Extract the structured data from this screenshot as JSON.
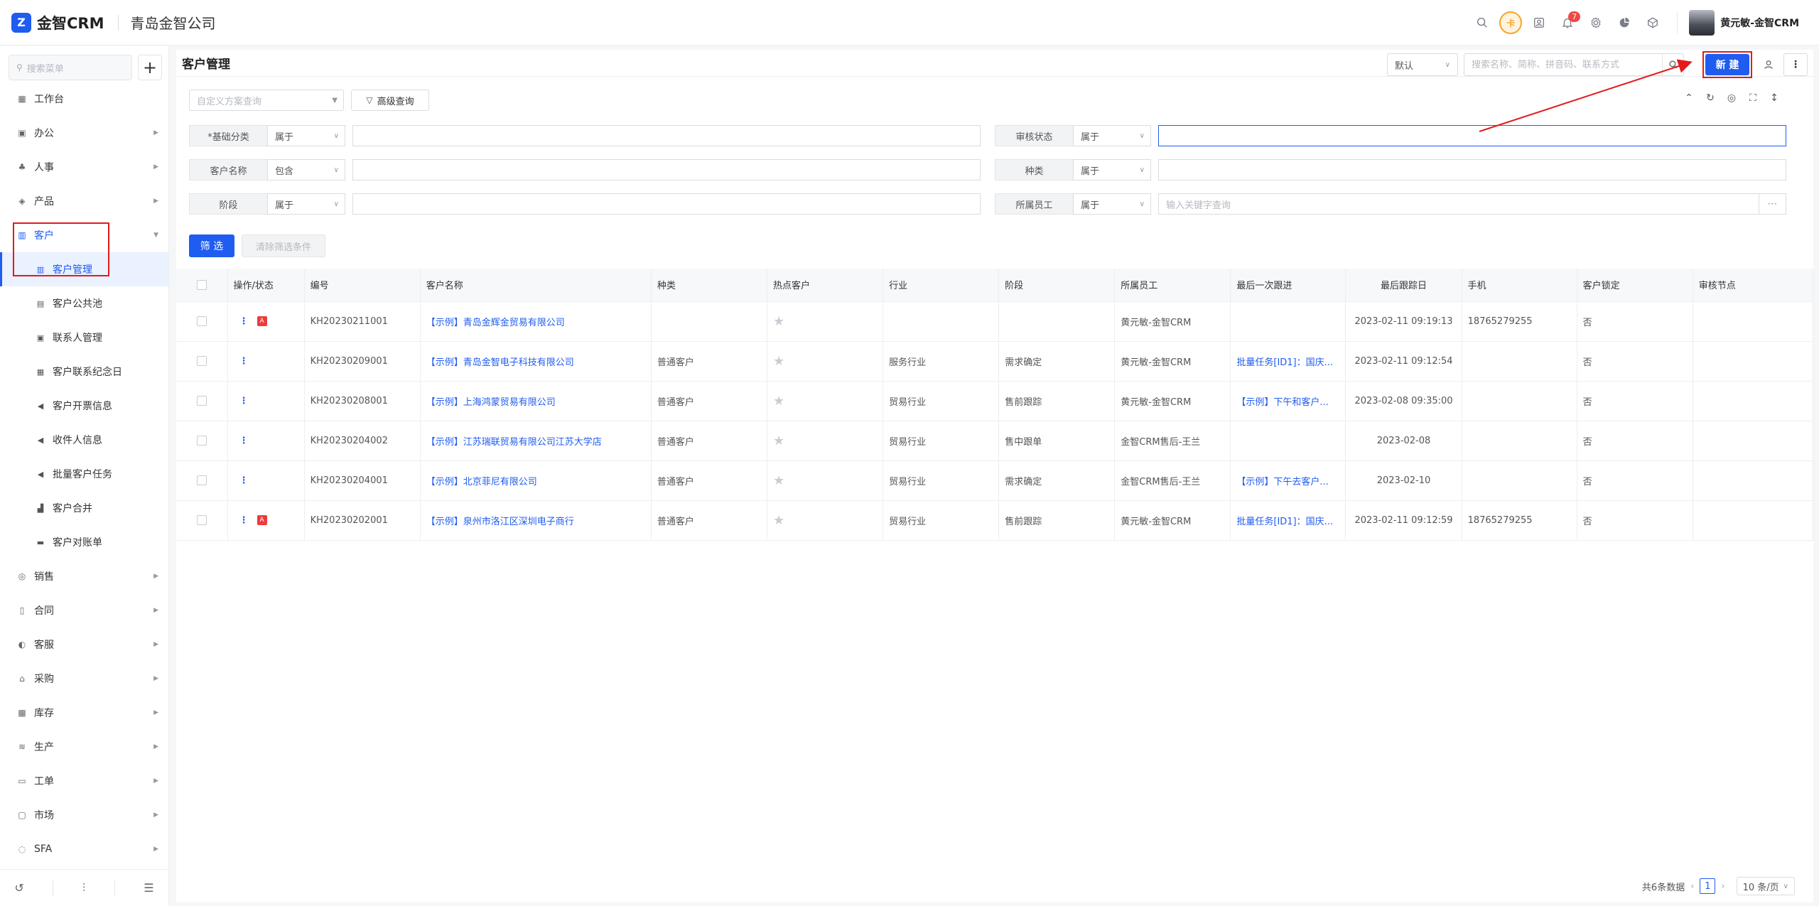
{
  "topbar": {
    "logo_mark": "Z",
    "app_name": "金智CRM",
    "company": "青岛金智公司",
    "notif_count": "7",
    "orange_icon_label": "卡",
    "user_name": "黄元敏-金智CRM"
  },
  "sidebar": {
    "search_placeholder": "搜索菜单",
    "add_label": "+",
    "items_top": [
      {
        "label": "工作台",
        "icon": "dashboard-icon",
        "glyph": "▦"
      },
      {
        "label": "办公",
        "icon": "office-icon",
        "glyph": "▣"
      },
      {
        "label": "人事",
        "icon": "people-icon",
        "glyph": "♣"
      },
      {
        "label": "产品",
        "icon": "product-icon",
        "glyph": "◈"
      }
    ],
    "customer": {
      "label": "客户",
      "icon": "customer-icon",
      "glyph": "▥"
    },
    "customer_sub": [
      {
        "label": "客户管理",
        "glyph": "▥",
        "icon": "customer-manage-icon"
      },
      {
        "label": "客户公共池",
        "glyph": "▤",
        "icon": "pool-icon"
      },
      {
        "label": "联系人管理",
        "glyph": "▣",
        "icon": "contact-icon"
      },
      {
        "label": "客户联系纪念日",
        "glyph": "▦",
        "icon": "calendar-icon"
      },
      {
        "label": "客户开票信息",
        "glyph": "◀",
        "icon": "invoice-icon"
      },
      {
        "label": "收件人信息",
        "glyph": "◀",
        "icon": "recipient-icon"
      },
      {
        "label": "批量客户任务",
        "glyph": "◀",
        "icon": "batch-task-icon"
      },
      {
        "label": "客户合并",
        "glyph": "▟",
        "icon": "merge-icon"
      },
      {
        "label": "客户对账单",
        "glyph": "▬",
        "icon": "statement-icon"
      }
    ],
    "items_bottom": [
      {
        "label": "销售",
        "icon": "sales-icon",
        "glyph": "◎"
      },
      {
        "label": "合同",
        "icon": "contract-icon",
        "glyph": "▯"
      },
      {
        "label": "客服",
        "icon": "service-icon",
        "glyph": "◐"
      },
      {
        "label": "采购",
        "icon": "purchase-icon",
        "glyph": "⌂"
      },
      {
        "label": "库存",
        "icon": "inventory-icon",
        "glyph": "▩"
      },
      {
        "label": "生产",
        "icon": "production-icon",
        "glyph": "≋"
      },
      {
        "label": "工单",
        "icon": "workorder-icon",
        "glyph": "▭"
      },
      {
        "label": "市场",
        "icon": "market-icon",
        "glyph": "▢"
      },
      {
        "label": "SFA",
        "icon": "sfa-icon",
        "glyph": "◌"
      }
    ]
  },
  "header": {
    "title": "客户管理",
    "view_select": "默认",
    "search_placeholder": "搜索名称、简称、拼音码、联系方式",
    "new_label": "新 建",
    "more_label": "⋮"
  },
  "filters": {
    "scheme_placeholder": "自定义方案查询",
    "advanced_label": "高级查询",
    "rows": [
      {
        "left_label": "*基础分类",
        "left_op": "属于",
        "left_val": "",
        "right_label": "审核状态",
        "right_op": "属于",
        "right_val": ""
      },
      {
        "left_label": "客户名称",
        "left_op": "包含",
        "left_val": "",
        "right_label": "种类",
        "right_op": "属于",
        "right_val": ""
      },
      {
        "left_label": "阶段",
        "left_op": "属于",
        "left_val": "",
        "right_label": "所属员工",
        "right_op": "属于",
        "right_val": "输入关键字查询"
      }
    ],
    "filter_btn": "筛 选",
    "clear_btn": "清除筛选条件"
  },
  "table": {
    "columns": [
      "",
      "操作/状态",
      "编号",
      "客户名称",
      "种类",
      "热点客户",
      "行业",
      "阶段",
      "所属员工",
      "最后一次跟进",
      "最后跟踪日",
      "手机",
      "客户锁定",
      "审核节点"
    ],
    "rows": [
      {
        "flag": true,
        "id": "KH20230211001",
        "name": "【示例】青岛金辉金贸易有限公司",
        "kind": "",
        "industry": "",
        "stage": "",
        "staff": "黄元敏-金智CRM",
        "last_follow": "",
        "last_date": "2023-02-11 09:19:13",
        "phone": "18765279255",
        "locked": "否",
        "node": ""
      },
      {
        "flag": false,
        "id": "KH20230209001",
        "name": "【示例】青岛金智电子科技有限公司",
        "kind": "普通客户",
        "industry": "服务行业",
        "stage": "需求确定",
        "staff": "黄元敏-金智CRM",
        "last_follow": "批量任务[ID1]：国庆...",
        "last_date": "2023-02-11 09:12:54",
        "phone": "",
        "locked": "否",
        "node": ""
      },
      {
        "flag": false,
        "id": "KH20230208001",
        "name": "【示例】上海鸿蒙贸易有限公司",
        "kind": "普通客户",
        "industry": "贸易行业",
        "stage": "售前跟踪",
        "staff": "黄元敏-金智CRM",
        "last_follow": "【示例】下午和客户...",
        "last_date": "2023-02-08 09:35:00",
        "phone": "",
        "locked": "否",
        "node": ""
      },
      {
        "flag": false,
        "id": "KH20230204002",
        "name": "【示例】江苏瑞联贸易有限公司江苏大学店",
        "kind": "普通客户",
        "industry": "贸易行业",
        "stage": "售中跟单",
        "staff": "金智CRM售后-王兰",
        "last_follow": "",
        "last_date": "2023-02-08",
        "phone": "",
        "locked": "否",
        "node": ""
      },
      {
        "flag": false,
        "id": "KH20230204001",
        "name": "【示例】北京菲尼有限公司",
        "kind": "普通客户",
        "industry": "贸易行业",
        "stage": "需求确定",
        "staff": "金智CRM售后-王兰",
        "last_follow": "【示例】下午去客户...",
        "last_date": "2023-02-10",
        "phone": "",
        "locked": "否",
        "node": ""
      },
      {
        "flag": true,
        "id": "KH20230202001",
        "name": "【示例】泉州市洛江区深圳电子商行",
        "kind": "普通客户",
        "industry": "贸易行业",
        "stage": "售前跟踪",
        "staff": "黄元敏-金智CRM",
        "last_follow": "批量任务[ID1]：国庆...",
        "last_date": "2023-02-11 09:12:59",
        "phone": "18765279255",
        "locked": "否",
        "node": ""
      }
    ]
  },
  "pager": {
    "total": "共6条数据",
    "current": "1",
    "page_size": "10 条/页"
  },
  "colors": {
    "accent": "#1f5cf0",
    "annotation": "#e31b1b"
  }
}
